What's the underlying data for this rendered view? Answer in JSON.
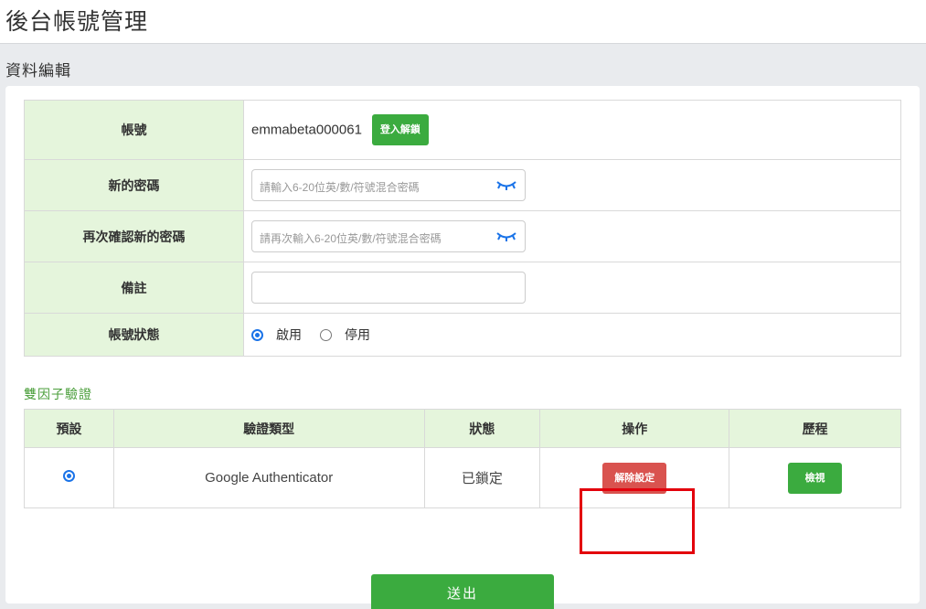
{
  "header": {
    "title": "後台帳號管理"
  },
  "section": {
    "title": "資料編輯"
  },
  "form": {
    "account": {
      "label": "帳號",
      "value": "emmabeta000061",
      "unlock_label": "登入解鎖"
    },
    "new_password": {
      "label": "新的密碼",
      "placeholder": "請輸入6-20位英/數/符號混合密碼"
    },
    "confirm_password": {
      "label": "再次確認新的密碼",
      "placeholder": "請再次輸入6-20位英/數/符號混合密碼"
    },
    "note": {
      "label": "備註",
      "value": ""
    },
    "status": {
      "label": "帳號狀態",
      "options": [
        "啟用",
        "停用"
      ],
      "selected": "啟用"
    }
  },
  "twofa": {
    "title": "雙因子驗證",
    "headers": [
      "預設",
      "驗證類型",
      "狀態",
      "操作",
      "歷程"
    ],
    "rows": [
      {
        "default_selected": true,
        "type": "Google Authenticator",
        "status": "已鎖定",
        "action_label": "解除設定",
        "history_label": "檢視"
      }
    ]
  },
  "submit": {
    "label": "送出"
  },
  "colors": {
    "accent_green": "#3bab3f",
    "danger_red": "#d9534f",
    "label_bg": "#e5f5dc",
    "highlight": "#e3010c"
  }
}
